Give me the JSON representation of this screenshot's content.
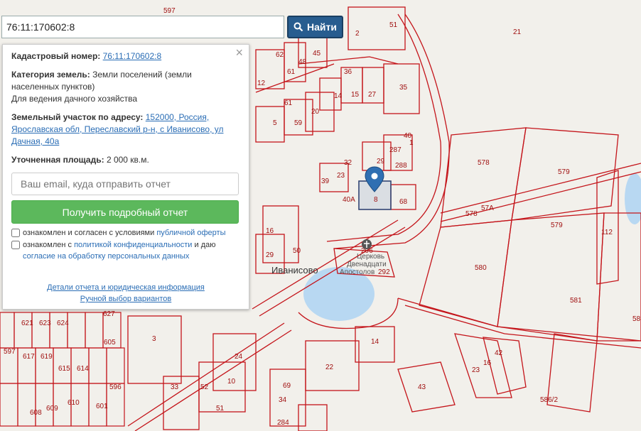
{
  "search": {
    "value": "76:11:170602:8",
    "button_label": "Найти"
  },
  "info": {
    "cadastral_label": "Кадастровый номер:",
    "cadastral_number": "76:11:170602:8",
    "category_label": "Категория земель:",
    "category_value": "Земли поселений (земли населенных пунктов)",
    "usage": "Для ведения дачного хозяйства",
    "address_label": "Земельный участок по адресу:",
    "address_value": "152000, Россия, Ярославская обл, Переславский р-н, с Иванисово, ул Дачная, 40а",
    "area_label": "Уточненная площадь:",
    "area_value": "2 000 кв.м.",
    "email_placeholder": "Ваш email, куда отправить отчет",
    "report_button": "Получить подробный отчет",
    "offer_text": "ознакомлен и согласен с условиями ",
    "offer_link": "публичной оферты",
    "privacy_text": "ознакомлен с ",
    "privacy_link": "политикой конфиденциальности",
    "privacy_and": " и даю",
    "consent_link": "согласие на обработку персональных данных",
    "details_link": "Детали отчета и юридическая информация",
    "manual_link": "Ручной выбор вариантов"
  },
  "map": {
    "village_label": "Иванисово",
    "church_label_1": "Церковь",
    "church_label_2": "Двенадцати",
    "church_label_3": "Апостолов",
    "parcels": [
      "597",
      "21",
      "51",
      "2",
      "45",
      "62",
      "61",
      "48",
      "12",
      "36",
      "14",
      "15",
      "27",
      "35",
      "61",
      "20",
      "5",
      "59",
      "40",
      "1",
      "287",
      "288",
      "29",
      "32",
      "23",
      "39",
      "40А",
      "8",
      "68",
      "578",
      "579",
      "578",
      "57А",
      "579",
      "112",
      "16",
      "29",
      "50",
      "296",
      "292",
      "580",
      "581",
      "58",
      "3",
      "24",
      "22",
      "14",
      "42",
      "16",
      "23",
      "43",
      "10",
      "69",
      "34",
      "33",
      "52",
      "51",
      "284",
      "586/2",
      "621",
      "623",
      "624",
      "627",
      "617",
      "619",
      "615",
      "614",
      "610",
      "609",
      "608",
      "601",
      "605",
      "596",
      "597"
    ]
  },
  "colors": {
    "accent": "#285d8f",
    "parcel": "#c4141a",
    "water": "#b8d8f2",
    "green": "#5cb85c"
  }
}
